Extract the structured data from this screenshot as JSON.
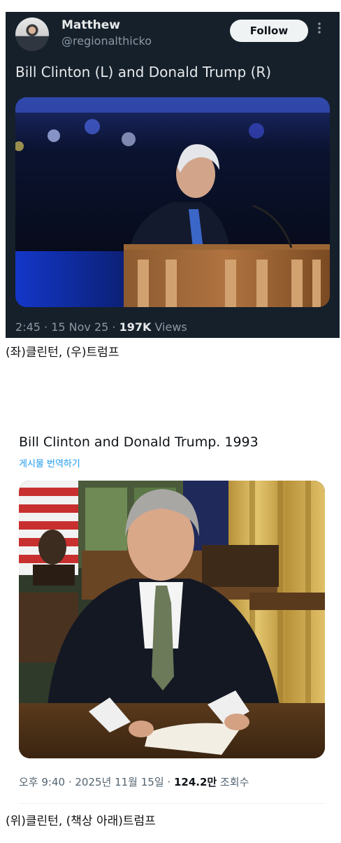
{
  "tweet1": {
    "author_name": "Matthew",
    "author_handle": "@regionalthicko",
    "follow_label": "Follow",
    "more_icon": "more-dots-icon",
    "text": "Bill Clinton (L) and Donald Trump (R)",
    "time_date": "2:45 · 15 Nov 25 · ",
    "views_count": "197K",
    "views_label": " Views"
  },
  "caption1": "(좌)클린턴, (우)트럼프",
  "tweet2": {
    "text": "Bill Clinton and Donald Trump. 1993",
    "translate_label": "게시물 번역하기",
    "time_date": "오후 9:40 · 2025년 11월 15일 · ",
    "views_count": "124.2만",
    "views_label": " 조회수"
  },
  "caption2": "(위)클린턴, (책상 아래)트럼프",
  "colors": {
    "dark_bg": "#15202b",
    "follow_bg": "#eff3f4",
    "link_blue": "#1d9bf0"
  }
}
